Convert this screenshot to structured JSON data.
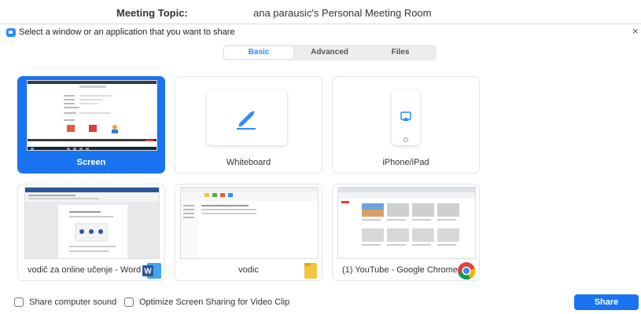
{
  "meeting": {
    "topic_label": "Meeting Topic:",
    "topic_value": "ana parausic's Personal Meeting Room"
  },
  "dialog": {
    "title": "Select a window or an application that you want to share",
    "close_icon": "×"
  },
  "tabs": [
    {
      "label": "Basic",
      "active": true
    },
    {
      "label": "Advanced",
      "active": false
    },
    {
      "label": "Files",
      "active": false
    }
  ],
  "cards": [
    {
      "label": "Screen",
      "selected": true
    },
    {
      "label": "Whiteboard",
      "selected": false,
      "icon": "pencil-icon"
    },
    {
      "label": "iPhone/iPad",
      "selected": false,
      "icon": "airplay-icon"
    },
    {
      "label": "vodič za online učenje - Word",
      "selected": false,
      "icon": "word-icon"
    },
    {
      "label": "vodic",
      "selected": false,
      "icon": "folder-icon"
    },
    {
      "label": "(1) YouTube - Google Chrome",
      "selected": false,
      "icon": "chrome-icon"
    }
  ],
  "options": {
    "share_sound": "Share computer sound",
    "optimize_video": "Optimize Screen Sharing for Video Clip"
  },
  "share_button": "Share",
  "colors": {
    "accent": "#1a73f0",
    "zoom_blue": "#2d8cff",
    "word_blue": "#2b579a",
    "folder_yellow": "#f4c542"
  }
}
